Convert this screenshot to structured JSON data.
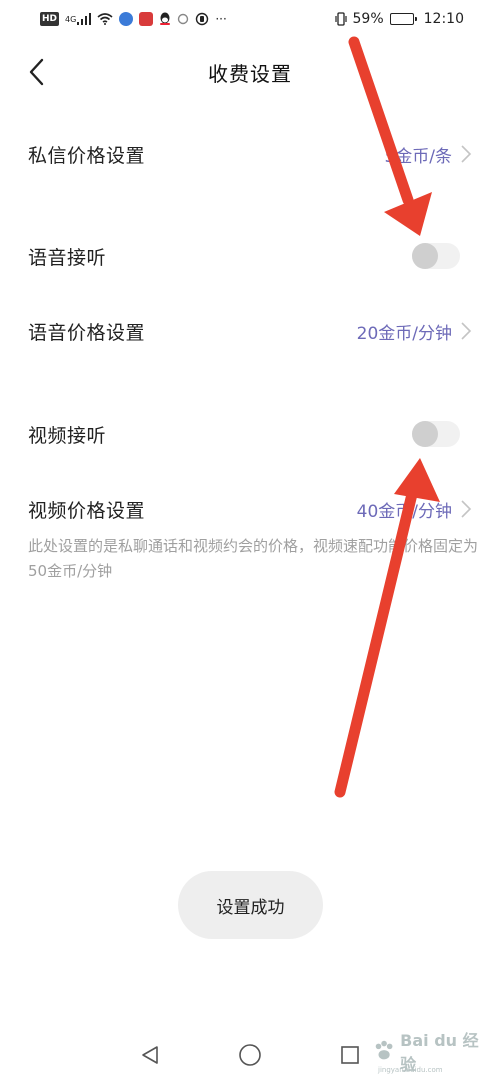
{
  "status_bar": {
    "left_icons": [
      "hd-badge",
      "signal-icon",
      "wifi-icon",
      "app-icon-blue",
      "app-icon-red",
      "qq-icon",
      "circle-icon",
      "ring-icon"
    ],
    "hd_label": "HD",
    "network_label": "4G",
    "more_label": "···",
    "battery_percent": "59%",
    "battery_level": 0.59,
    "time": "12:10"
  },
  "header": {
    "title": "收费设置",
    "back_icon": "chevron-left-icon"
  },
  "settings": {
    "message_price": {
      "label": "私信价格设置",
      "value": "5金币/条"
    },
    "voice_answer": {
      "label": "语音接听",
      "enabled": false
    },
    "voice_price": {
      "label": "语音价格设置",
      "value": "20金币/分钟"
    },
    "video_answer": {
      "label": "视频接听",
      "enabled": false
    },
    "video_price": {
      "label": "视频价格设置",
      "value": "40金币/分钟"
    }
  },
  "note": "此处设置的是私聊通话和视频约会的价格，视频速配功能价格固定为50金币/分钟",
  "toast": "设置成功",
  "colors": {
    "accent_value": "#6d6ab8",
    "note_text": "#a0a0a0",
    "arrow_red": "#e8402e",
    "toggle_knob": "#cfcfcf"
  },
  "watermark": {
    "text": "Bai du 经验",
    "subtext": "jingyan.baidu.com"
  },
  "system_nav": {
    "back": "triangle-back-icon",
    "home": "circle-home-icon",
    "recents": "square-recents-icon"
  }
}
